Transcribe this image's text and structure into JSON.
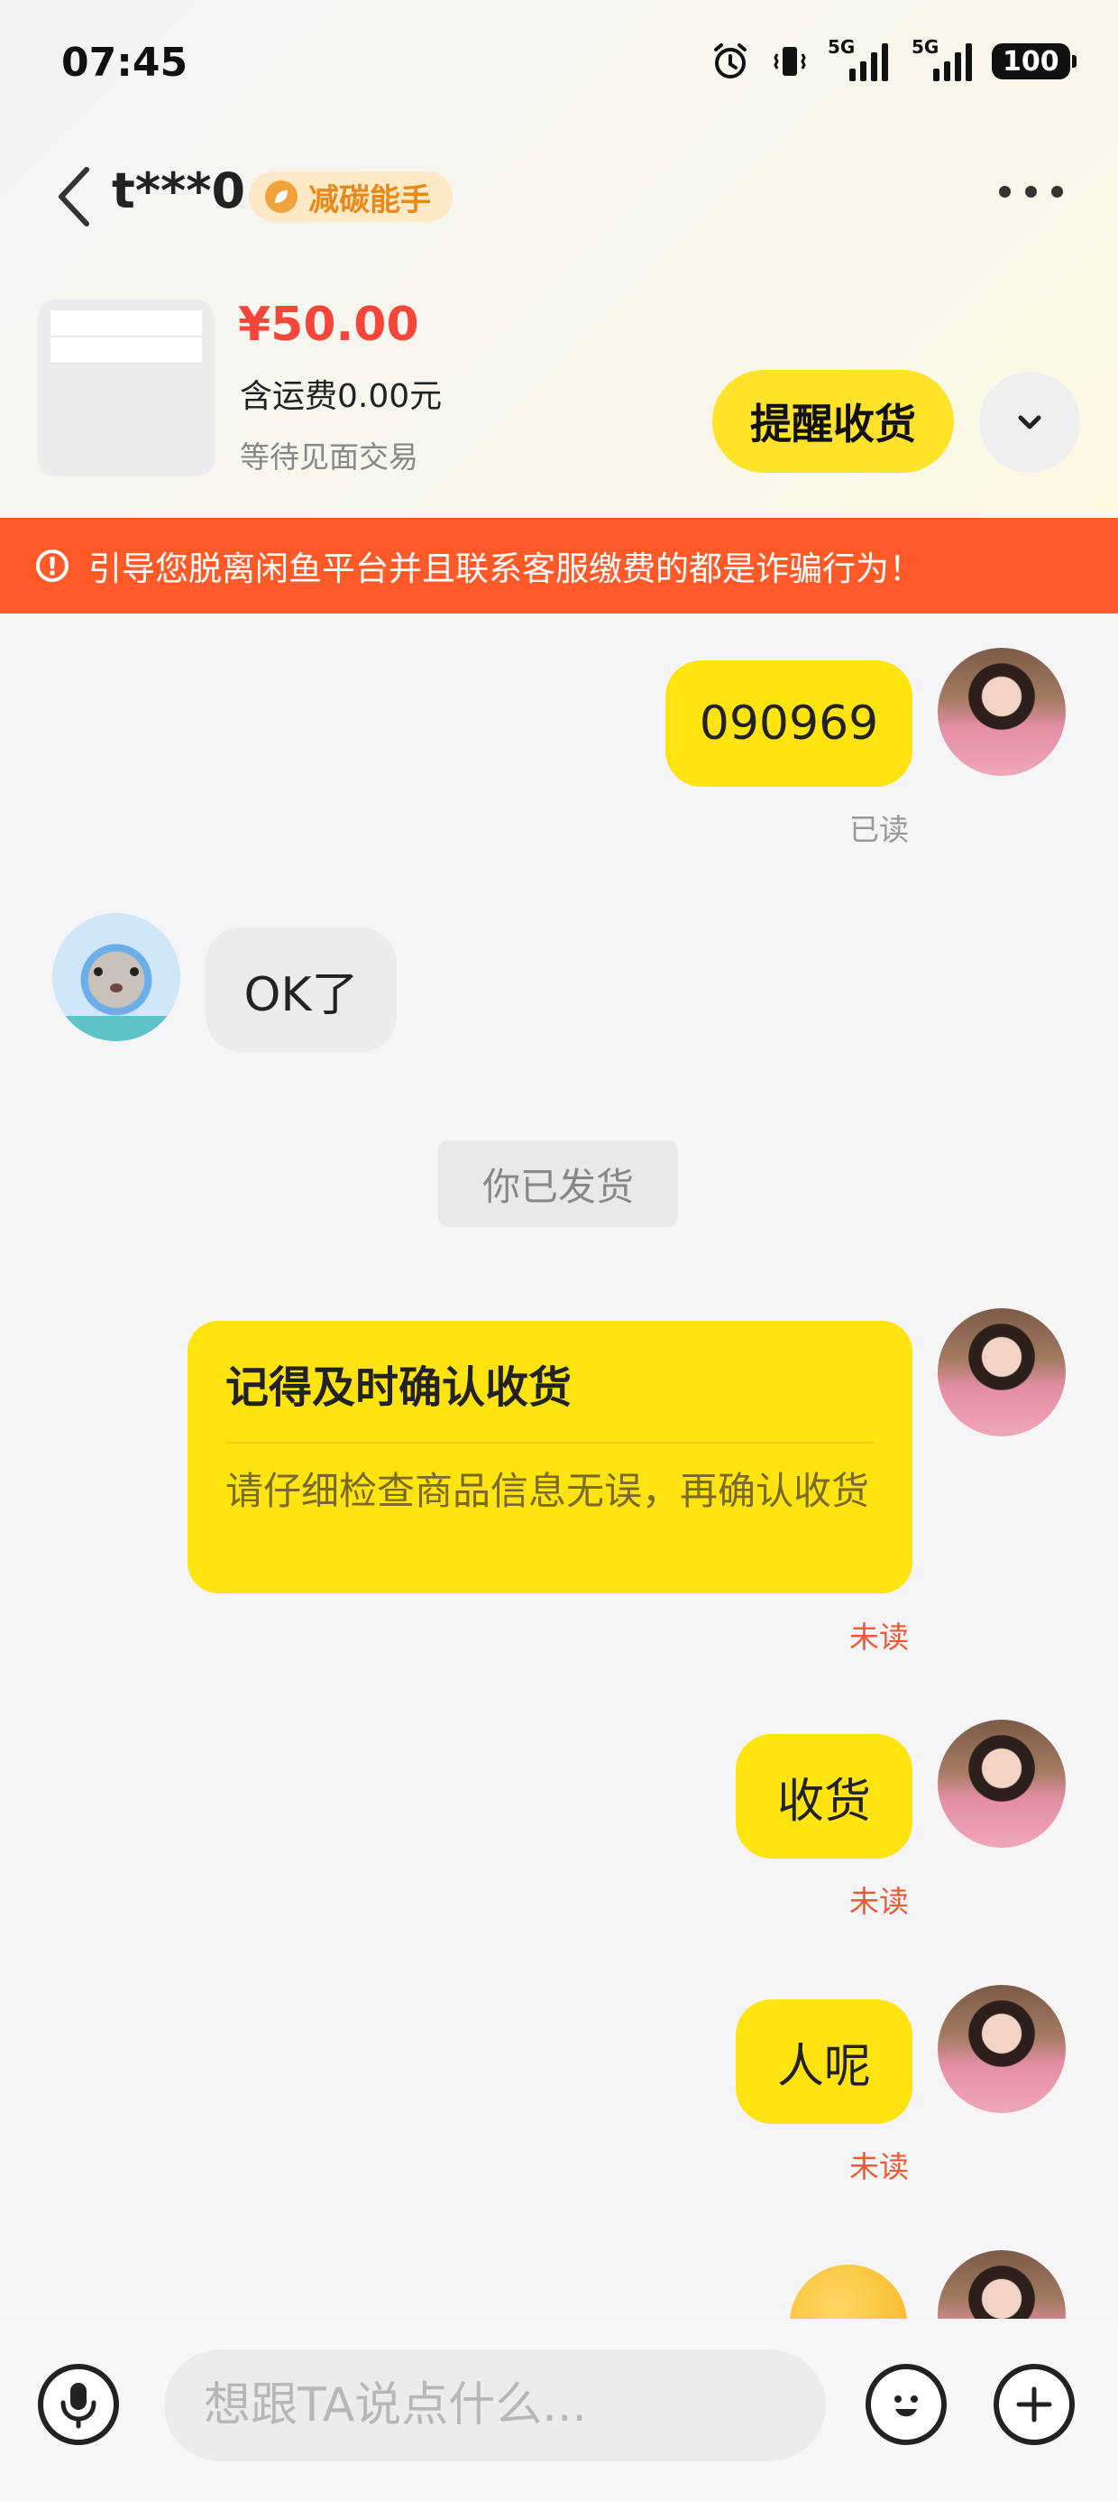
{
  "status_bar": {
    "time": "07:45",
    "signal_1": "5G",
    "signal_2": "5G",
    "battery": "100"
  },
  "header": {
    "title": "t***0",
    "badge": "减碳能手"
  },
  "product": {
    "price": "¥50.00",
    "shipping": "含运费0.00元",
    "status": "等待见面交易",
    "remind_label": "提醒收货"
  },
  "warning": {
    "text": "引导您脱离闲鱼平台并且联系客服缴费的都是诈骗行为！"
  },
  "messages": {
    "m1": {
      "text": "090969",
      "status": "已读"
    },
    "m2": {
      "text": "OK了"
    },
    "system": {
      "text": "你已发货"
    },
    "card": {
      "title": "记得及时确认收货",
      "body": "请仔细检查商品信息无误，再确认收货",
      "status": "未读"
    },
    "m4": {
      "text": "收货",
      "status": "未读"
    },
    "m5": {
      "text": "人呢",
      "status": "未读"
    }
  },
  "input": {
    "placeholder": "想跟TA说点什么..."
  },
  "colors": {
    "accent_yellow": "#FFE411",
    "warning_orange": "#FF5A27",
    "price_red": "#F4463A",
    "unread_red": "#EE5A36"
  }
}
